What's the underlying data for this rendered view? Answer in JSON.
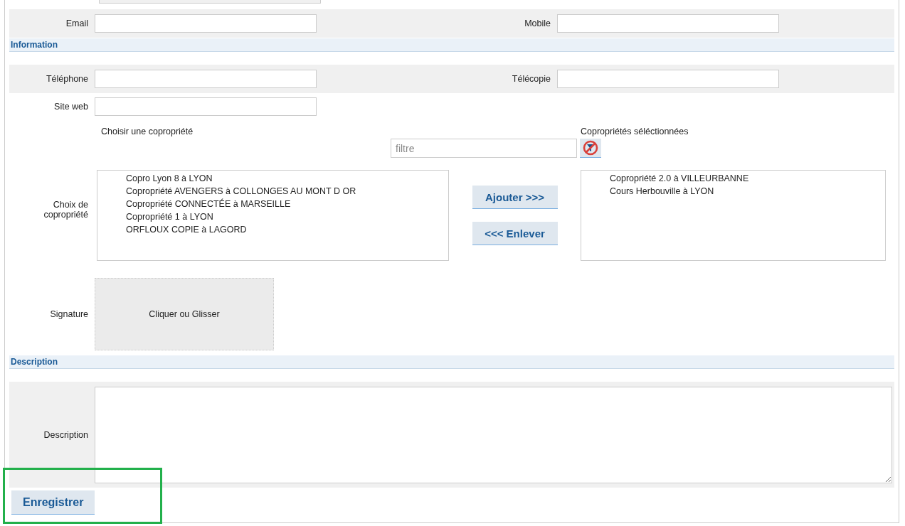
{
  "form": [
    {
      "kind": "stub"
    },
    {
      "kind": "fields",
      "shaded": true,
      "fields": [
        {
          "label": "Email"
        },
        {
          "label": "Mobile"
        }
      ]
    },
    {
      "kind": "header",
      "title": "Information"
    },
    {
      "kind": "fields",
      "shaded": true,
      "fields": [
        {
          "label": "Téléphone"
        },
        {
          "label": "Télécopie"
        }
      ]
    },
    {
      "kind": "fields",
      "fields": [
        {
          "label": "Site web"
        }
      ]
    },
    {
      "kind": "picker",
      "label": "Choix de copropriété",
      "available_title": "Choisir une copropriété",
      "selected_title": "Copropriétés séléctionnées",
      "filter": {
        "placeholder": "filtre"
      },
      "add_button": "Ajouter >>>",
      "remove_button": "<<< Enlever",
      "available": [
        "Copro Lyon 8 à LYON",
        "Copropriété AVENGERS à COLLONGES AU MONT D OR",
        "Copropriété CONNECTÉE à MARSEILLE",
        "Copropriété 1 à LYON",
        "ORFLOUX COPIE à LAGORD"
      ],
      "chosen": [
        "Copropriété 2.0 à VILLEURBANNE",
        "Cours Herbouville à LYON"
      ]
    },
    {
      "kind": "upload",
      "label": "Signature",
      "prompt": "Cliquer ou Glisser"
    },
    {
      "kind": "header",
      "title": "Description"
    },
    {
      "kind": "textarea",
      "shaded": true,
      "label": "Description"
    }
  ],
  "save_button": {
    "label": "Enregistrer",
    "highlighted": true
  }
}
